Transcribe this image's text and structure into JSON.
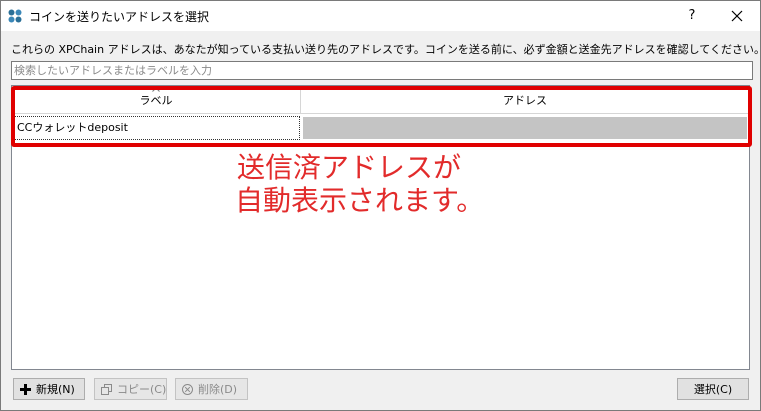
{
  "window": {
    "title": "コインを送りたいアドレスを選択",
    "help_label": "?"
  },
  "description": "これらの XPChain アドレスは、あなたが知っている支払い送り先のアドレスです。コインを送る前に、必ず金額と送金先アドレスを確認してください。",
  "search": {
    "placeholder": "検索したいアドレスまたはラベルを入力",
    "value": ""
  },
  "table": {
    "columns": [
      "ラベル",
      "アドレス"
    ],
    "rows": [
      {
        "label": "CCウォレットdeposit",
        "address": ""
      }
    ]
  },
  "annotation": {
    "line1": "送信済アドレスが",
    "line2": "自動表示されます。"
  },
  "buttons": {
    "new": "新規(N)",
    "copy": "コピー(C)",
    "delete": "削除(D)",
    "choose": "選択(C)"
  },
  "colors": {
    "highlight": "#e00000",
    "annotation_text": "#e22b2b",
    "redacted_cell": "#c4c4c4"
  }
}
